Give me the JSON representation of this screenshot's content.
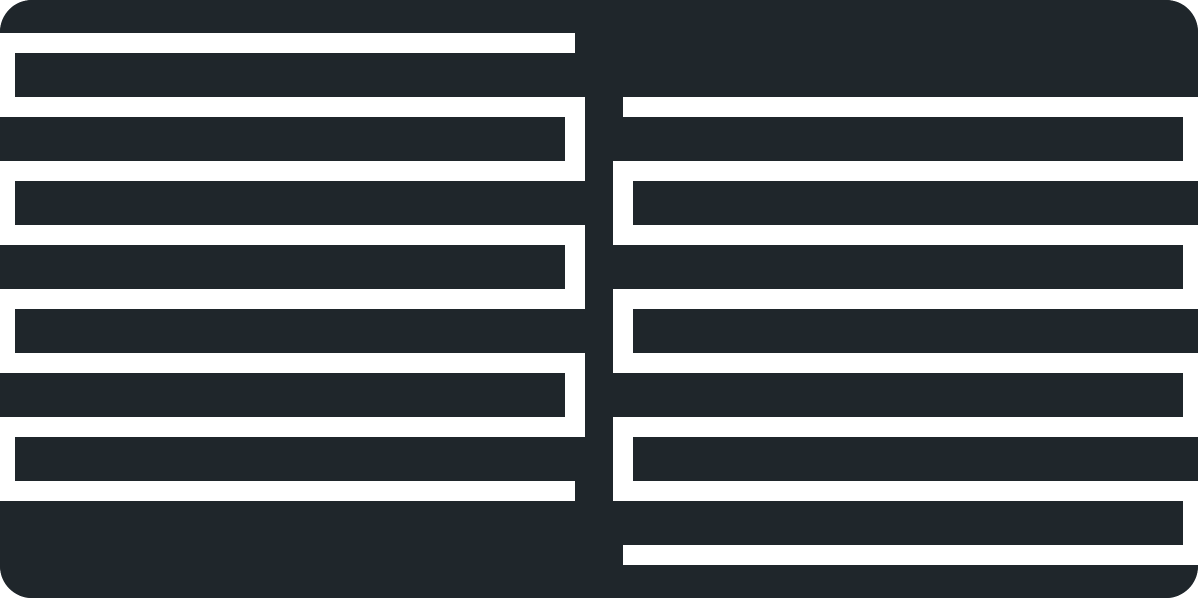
{
  "colors": {
    "background": "#1f262b",
    "path": "#ffffff"
  },
  "graphic": {
    "name": "serpentine-maze-pattern"
  }
}
